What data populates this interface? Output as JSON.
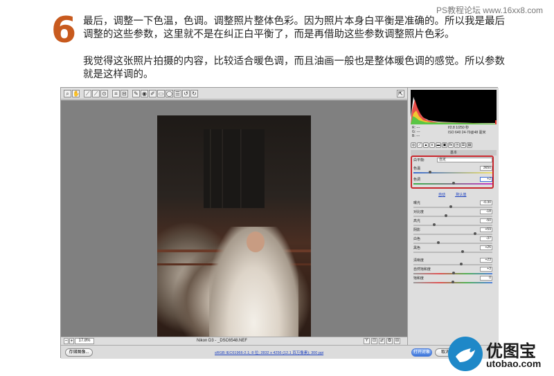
{
  "watermark": "PS教程论坛 www.16xx8.com",
  "step": "6",
  "paragraph1": "最后，调整一下色温，色调。调整照片整体色彩。因为照片本身白平衡是准确的。所以我是最后调整的这些参数，这里就不是在纠正白平衡了，而是再借助这些参数调整照片色彩。",
  "paragraph2": "我觉得这张照片拍摄的内容，比较适合暖色调，而且油画一般也是整体暖色调的感觉。所以参数就是这样调的。",
  "toolbar": {
    "tools": [
      "zoom-tool",
      "hand-tool",
      "white-balance-tool",
      "color-sampler-tool",
      "targeted-adjustment-tool",
      "crop-tool",
      "straighten-tool",
      "spot-removal-tool",
      "red-eye-tool",
      "adjustment-brush-tool",
      "graduated-filter-tool",
      "radial-filter-tool",
      "preferences-tool",
      "rotate-left-tool",
      "rotate-right-tool"
    ]
  },
  "statusbar": {
    "zoom": "17.8%",
    "filename": "Nikon D3 - _DSC6548.NEF"
  },
  "histogram_info": {
    "r": "R: ---",
    "g": "G: ---",
    "b": "B: ---",
    "aperture_shutter": "f/2.8   1/250 秒",
    "iso_lens": "ISO 640   24-70@48 毫米"
  },
  "panel": {
    "section_title": "基本",
    "white_balance_label": "白平衡:",
    "white_balance_value": "自定",
    "temperature_label": "色温",
    "temperature_value": "3650",
    "tint_label": "色调",
    "tint_value": "+2",
    "auto_label": "自动",
    "default_label": "默认值",
    "sliders": [
      {
        "label": "曝光",
        "value": "-0.30",
        "pos": 0.47
      },
      {
        "label": "对比度",
        "value": "-18",
        "pos": 0.41
      },
      {
        "label": "高光",
        "value": "-50",
        "pos": 0.25
      },
      {
        "label": "阴影",
        "value": "+59",
        "pos": 0.79
      },
      {
        "label": "白色",
        "value": "-37",
        "pos": 0.31
      },
      {
        "label": "黑色",
        "value": "+26",
        "pos": 0.63
      }
    ],
    "presence": [
      {
        "label": "清晰度",
        "value": "+23",
        "pos": 0.61
      },
      {
        "label": "自然饱和度",
        "value": "+3",
        "pos": 0.51
      },
      {
        "label": "饱和度",
        "value": "0",
        "pos": 0.5
      }
    ]
  },
  "bottombar": {
    "save_label": "存储图像...",
    "workflow_label": "sRGB IEC61966-2.1; 8 位; 2832 x 4256 (12.1 百万像素); 300 ppi",
    "open_label": "打开对象",
    "cancel_label": "取消"
  },
  "logo": {
    "title": "优图宝",
    "url": "utobao.com"
  }
}
